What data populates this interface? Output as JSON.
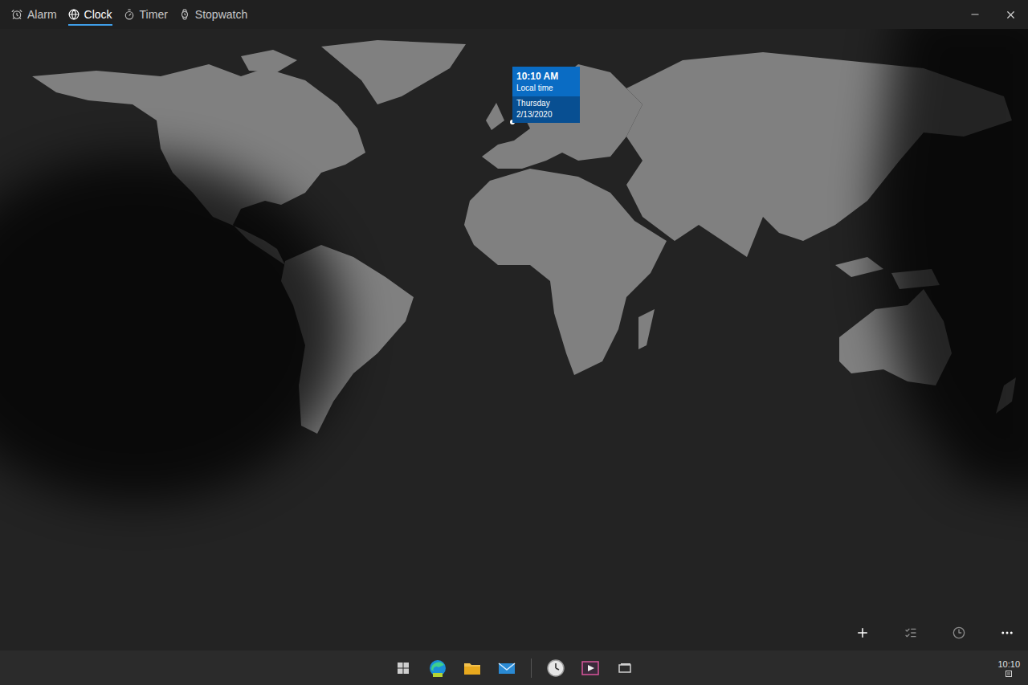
{
  "tabs": [
    {
      "label": "Alarm",
      "selected": false
    },
    {
      "label": "Clock",
      "selected": true
    },
    {
      "label": "Timer",
      "selected": false
    },
    {
      "label": "Stopwatch",
      "selected": false
    }
  ],
  "map_pin": {
    "time": "10:10 AM",
    "label": "Local time",
    "day": "Thursday",
    "date": "2/13/2020"
  },
  "taskbar": {
    "time": "10:10"
  }
}
